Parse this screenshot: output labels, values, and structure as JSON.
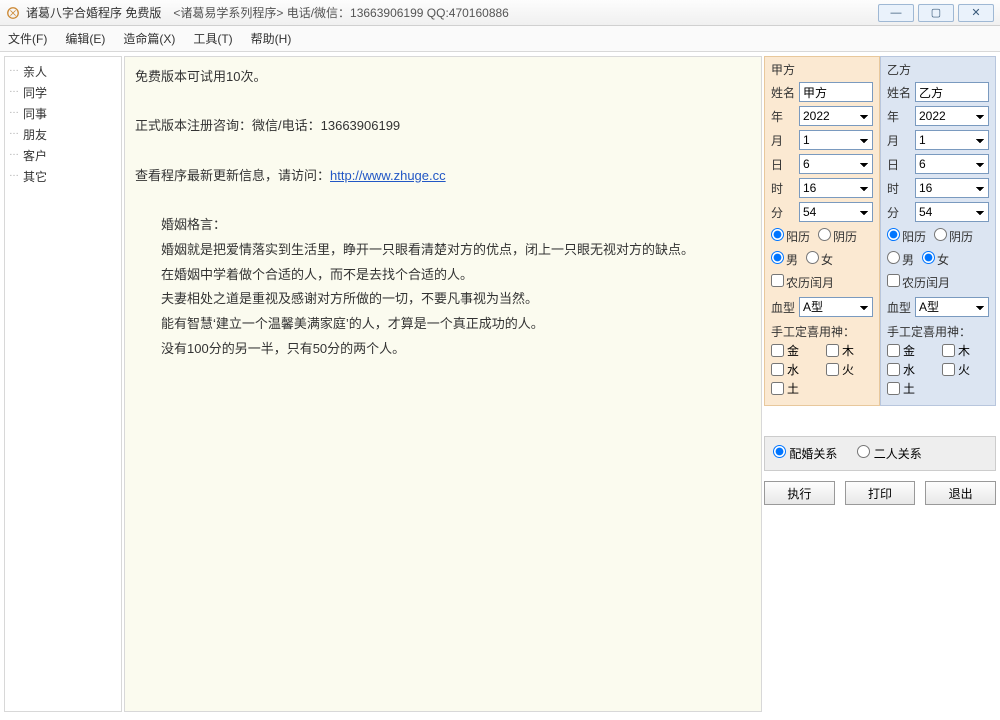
{
  "window": {
    "title_main": "诸葛八字合婚程序  免费版",
    "title_sub": "<诸葛易学系列程序>   电话/微信：13663906199   QQ:470160886",
    "btn_min": "—",
    "btn_max": "▢",
    "btn_close": "✕"
  },
  "menu": {
    "file": "文件(F)",
    "edit": "编辑(E)",
    "make": "造命篇(X)",
    "tools": "工具(T)",
    "help": "帮助(H)"
  },
  "sidebar": {
    "items": [
      "亲人",
      "同学",
      "同事",
      "朋友",
      "客户",
      "其它"
    ]
  },
  "content": {
    "line1": "免费版本可试用10次。",
    "line2_pre": "正式版本注册咨询：微信/电话：",
    "line2_phone": "13663906199",
    "line3_pre": "查看程序最新更新信息，请访问：",
    "line3_link": "http://www.zhuge.cc",
    "quote_title": "婚姻格言：",
    "quote1": "婚姻就是把爱情落实到生活里，睁开一只眼看清楚对方的优点，闭上一只眼无视对方的缺点。",
    "quote2": "在婚姻中学着做个合适的人，而不是去找个合适的人。",
    "quote3": "夫妻相处之道是重视及感谢对方所做的一切，不要凡事视为当然。",
    "quote4": "能有智慧‘建立一个温馨美满家庭’的人，才算是一个真正成功的人。",
    "quote5": "没有100分的另一半，只有50分的两个人。"
  },
  "labels": {
    "name": "姓名",
    "year": "年",
    "month": "月",
    "day": "日",
    "hour": "时",
    "minute": "分",
    "solar": "阳历",
    "lunar": "阴历",
    "male": "男",
    "female": "女",
    "leap": "农历闰月",
    "blood": "血型",
    "gods": "手工定喜用神：",
    "jin": "金",
    "mu": "木",
    "shui": "水",
    "huo": "火",
    "tu": "土"
  },
  "panelA": {
    "title": "甲方",
    "name": "甲方",
    "year": "2022",
    "month": "1",
    "day": "6",
    "hour": "16",
    "minute": "54",
    "blood": "A型",
    "cal": "solar",
    "sex": "male",
    "leap": false
  },
  "panelB": {
    "title": "乙方",
    "name": "乙方",
    "year": "2022",
    "month": "1",
    "day": "6",
    "hour": "16",
    "minute": "54",
    "blood": "A型",
    "cal": "solar",
    "sex": "female",
    "leap": false
  },
  "bottom": {
    "mode1": "配婚关系",
    "mode2": "二人关系",
    "exec": "执行",
    "print": "打印",
    "exit": "退出"
  }
}
